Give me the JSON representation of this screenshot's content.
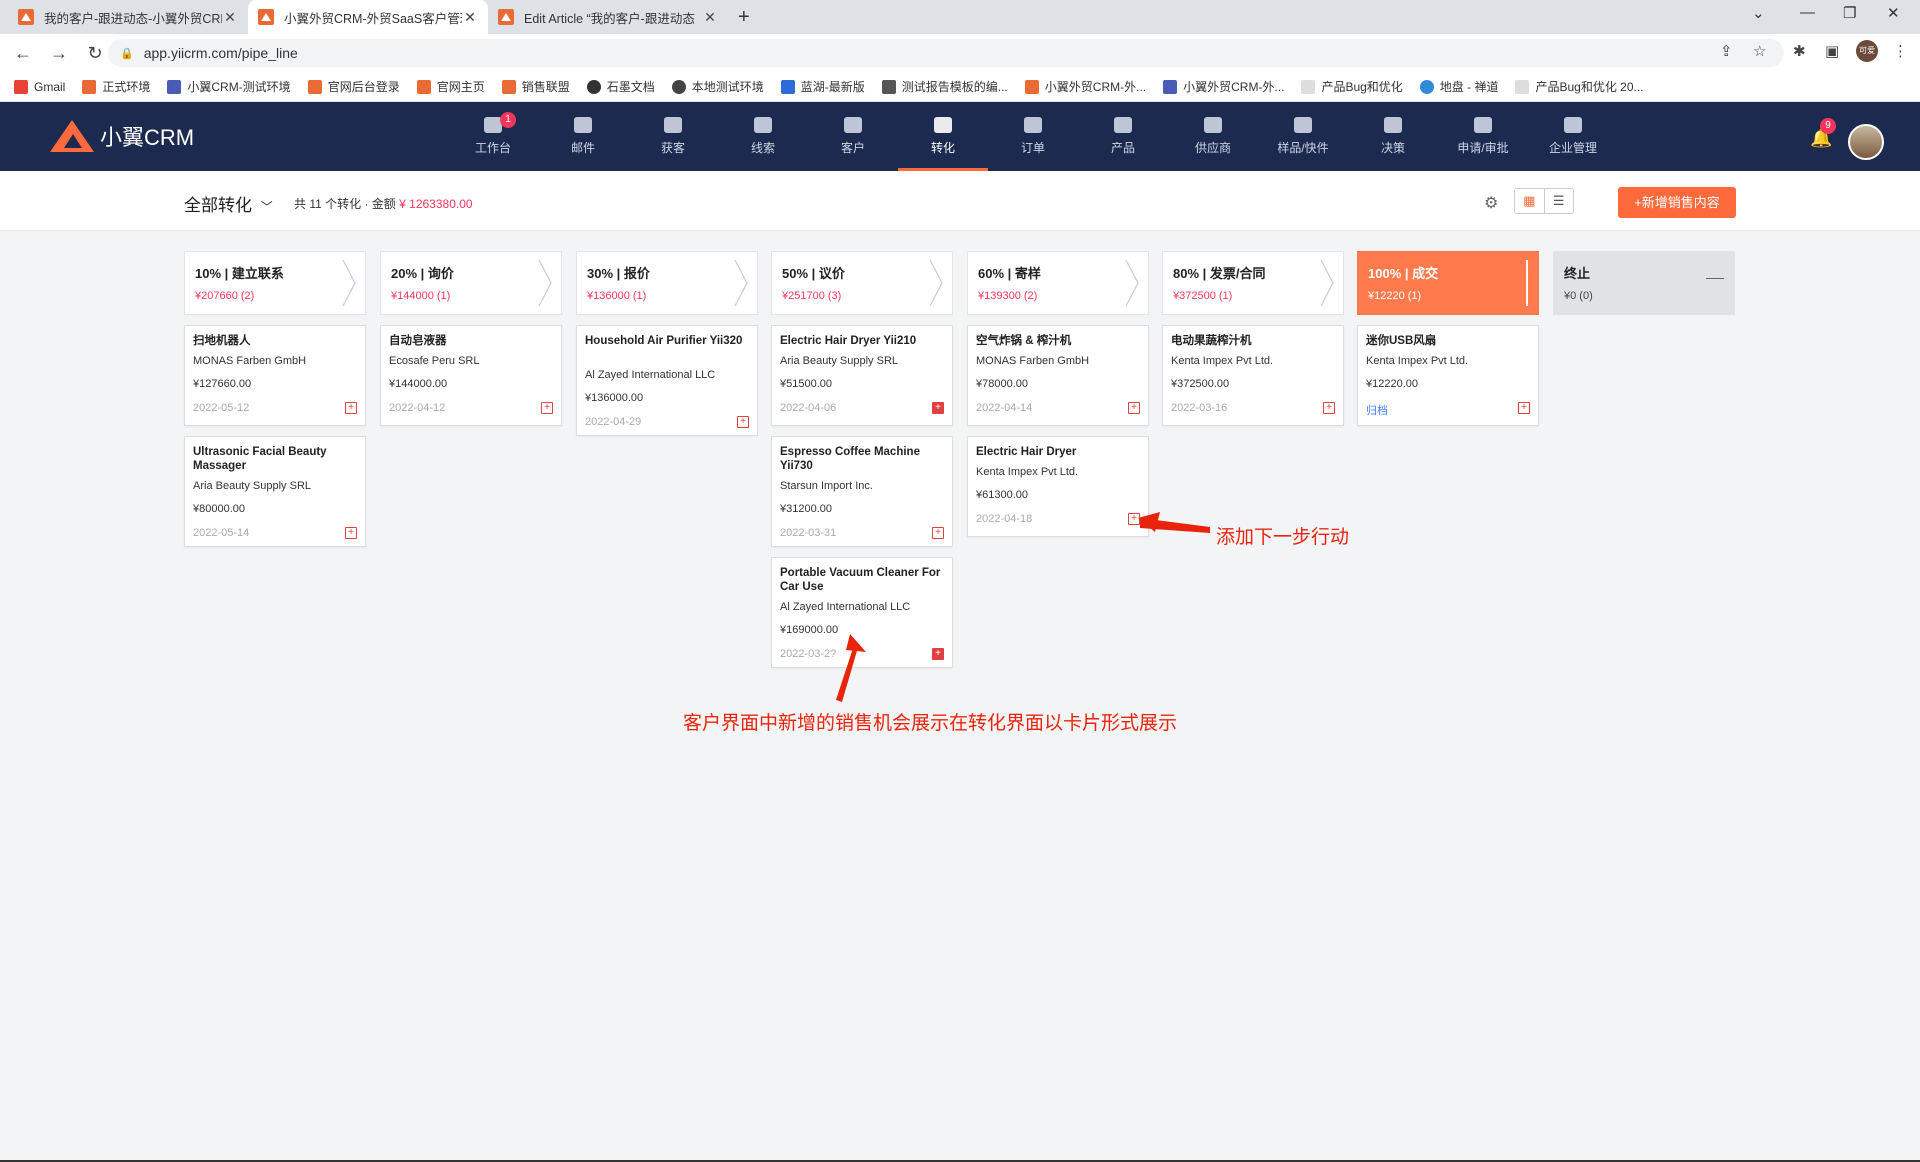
{
  "browser": {
    "tabs": [
      {
        "title": "我的客户-跟进动态-小翼外贸CRM",
        "active": false
      },
      {
        "title": "小翼外贸CRM-外贸SaaS客户管理",
        "active": true
      },
      {
        "title": "Edit Article “我的客户-跟进动态",
        "active": false
      }
    ],
    "url": "app.yiicrm.com/pipe_line",
    "profile_label": "可爱",
    "bookmarks": [
      {
        "label": "Gmail",
        "color": "#ea4335"
      },
      {
        "label": "正式环境",
        "color": "#ea6a35"
      },
      {
        "label": "小翼CRM-测试环境",
        "color": "#4b5bb5"
      },
      {
        "label": "官网后台登录",
        "color": "#ea6a35"
      },
      {
        "label": "官网主页",
        "color": "#ea6a35"
      },
      {
        "label": "销售联盟",
        "color": "#ea6a35"
      },
      {
        "label": "石墨文档",
        "color": "#333333"
      },
      {
        "label": "本地测试环境",
        "color": "#444444"
      },
      {
        "label": "蓝湖-最新版",
        "color": "#2f6bd8"
      },
      {
        "label": "测试报告模板的编...",
        "color": "#555555"
      },
      {
        "label": "小翼外贸CRM-外...",
        "color": "#ea6a35"
      },
      {
        "label": "小翼外贸CRM-外...",
        "color": "#4b5bb5"
      },
      {
        "label": "产品Bug和优化",
        "color": "#cccccc"
      },
      {
        "label": "地盘 - 禅道",
        "color": "#2f8ad8"
      },
      {
        "label": "产品Bug和优化 20...",
        "color": "#cccccc"
      }
    ]
  },
  "app": {
    "logo_text": "小翼CRM",
    "nav": [
      {
        "label": "工作台",
        "icon": "dashboard-icon",
        "badge": "1"
      },
      {
        "label": "邮件",
        "icon": "mail-icon"
      },
      {
        "label": "获客",
        "icon": "acquire-icon"
      },
      {
        "label": "线索",
        "icon": "leads-icon"
      },
      {
        "label": "客户",
        "icon": "customer-icon"
      },
      {
        "label": "转化",
        "icon": "funnel-icon",
        "active": true
      },
      {
        "label": "订单",
        "icon": "order-icon"
      },
      {
        "label": "产品",
        "icon": "product-icon"
      },
      {
        "label": "供应商",
        "icon": "supplier-icon"
      },
      {
        "label": "样品/快件",
        "icon": "sample-icon"
      },
      {
        "label": "决策",
        "icon": "chart-icon"
      },
      {
        "label": "申请/审批",
        "icon": "approval-icon"
      },
      {
        "label": "企业管理",
        "icon": "company-icon"
      }
    ],
    "notification_count": "9"
  },
  "toolbar": {
    "scope": "全部转化",
    "summary_prefix": "共 11 个转化 · 金额",
    "summary_amount": "¥ 1263380.00",
    "add_button": "+新增销售内容"
  },
  "stages": [
    {
      "pct": "10%",
      "name": "建立联系",
      "value": "¥207660 (2)"
    },
    {
      "pct": "20%",
      "name": "询价",
      "value": "¥144000 (1)"
    },
    {
      "pct": "30%",
      "name": "报价",
      "value": "¥136000 (1)"
    },
    {
      "pct": "50%",
      "name": "议价",
      "value": "¥251700 (3)"
    },
    {
      "pct": "60%",
      "name": "寄样",
      "value": "¥139300 (2)"
    },
    {
      "pct": "80%",
      "name": "发票/合同",
      "value": "¥372500 (1)"
    },
    {
      "pct": "100%",
      "name": "成交",
      "value": "¥12220 (1)"
    },
    {
      "pct": "",
      "name": "终止",
      "value": "¥0 (0)"
    }
  ],
  "stage_titles": [
    "10% | 建立联系",
    "20% | 询价",
    "30% | 报价",
    "50% | 议价",
    "60% | 寄样",
    "80% | 发票/合同",
    "100% | 成交",
    "终止"
  ],
  "cards": [
    [
      {
        "title": "扫地机器人",
        "company": "MONAS Farben GmbH",
        "amount": "¥127660.00",
        "date": "2022-05-12"
      },
      {
        "title": "Ultrasonic Facial Beauty Massager",
        "company": "Aria Beauty Supply SRL",
        "amount": "¥80000.00",
        "date": "2022-05-14"
      }
    ],
    [
      {
        "title": "自动皂液器",
        "company": "Ecosafe Peru SRL",
        "amount": "¥144000.00",
        "date": "2022-04-12"
      }
    ],
    [
      {
        "title": "Household Air Purifier Yii320",
        "company": "Al Zayed International LLC",
        "amount": "¥136000.00",
        "date": "2022-04-29"
      }
    ],
    [
      {
        "title": "Electric Hair Dryer Yii210",
        "company": "Aria Beauty Supply SRL",
        "amount": "¥51500.00",
        "date": "2022-04-06",
        "overdue": true
      },
      {
        "title": "Espresso Coffee Machine Yii730",
        "company": "Starsun Import Inc.",
        "amount": "¥31200.00",
        "date": "2022-03-31"
      },
      {
        "title": "Portable Vacuum Cleaner For Car Use",
        "company": "Al Zayed International LLC",
        "amount": "¥169000.00",
        "date": "2022-03-2?",
        "overdue": true
      }
    ],
    [
      {
        "title": "空气炸锅 & 榨汁机",
        "company": "MONAS Farben GmbH",
        "amount": "¥78000.00",
        "date": "2022-04-14"
      },
      {
        "title": "Electric Hair Dryer",
        "company": "Kenta Impex Pvt Ltd.",
        "amount": "¥61300.00",
        "date": "2022-04-18"
      }
    ],
    [
      {
        "title": "电动果蔬榨汁机",
        "company": "Kenta Impex Pvt Ltd.",
        "amount": "¥372500.00",
        "date": "2022-03-16"
      }
    ],
    [
      {
        "title": "迷你USB风扇",
        "company": "Kenta Impex Pvt Ltd.",
        "amount": "¥12220.00",
        "date": "归档",
        "archived": true
      }
    ]
  ],
  "annotations": {
    "next_action": "添加下一步行动",
    "card_display": "客户界面中新增的销售机会展示在转化界面以卡片形式展示"
  }
}
